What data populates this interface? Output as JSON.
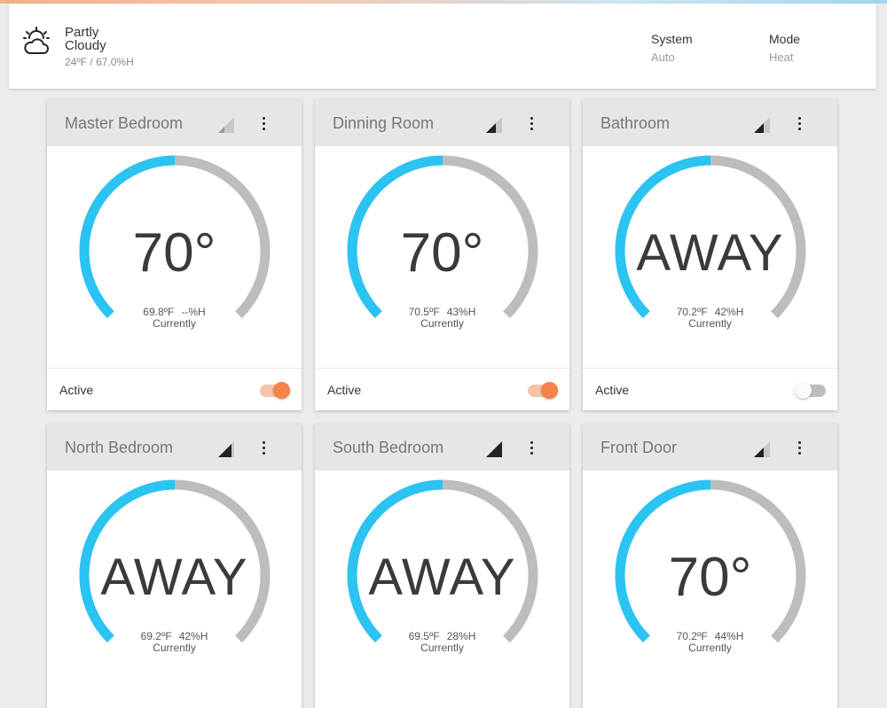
{
  "weather": {
    "condition": "Partly Cloudy",
    "readout": "24ºF / 67.0%H",
    "icon": "partly-cloudy-icon"
  },
  "system": {
    "label": "System",
    "value": "Auto"
  },
  "mode": {
    "label": "Mode",
    "value": "Heat"
  },
  "colors": {
    "accent": "#2bc4f2",
    "track": "#bdbdbd",
    "toggle_on": "#f5834a"
  },
  "thermostats": [
    {
      "name": "Master Bedroom",
      "setpoint": "70°",
      "temp": "69.8ºF",
      "humidity": "--%H",
      "status": "Currently",
      "active_label": "Active",
      "active": true
    },
    {
      "name": "Dinning Room",
      "setpoint": "70°",
      "temp": "70.5ºF",
      "humidity": "43%H",
      "status": "Currently",
      "active_label": "Active",
      "active": true
    },
    {
      "name": "Bathroom",
      "setpoint": "AWAY",
      "temp": "70.2ºF",
      "humidity": "42%H",
      "status": "Currently",
      "active_label": "Active",
      "active": false
    },
    {
      "name": "North Bedroom",
      "setpoint": "AWAY",
      "temp": "69.2ºF",
      "humidity": "42%H",
      "status": "Currently"
    },
    {
      "name": "South Bedroom",
      "setpoint": "AWAY",
      "temp": "69.5ºF",
      "humidity": "28%H",
      "status": "Currently"
    },
    {
      "name": "Front Door",
      "setpoint": "70°",
      "temp": "70.2ºF",
      "humidity": "44%H",
      "status": "Currently"
    }
  ]
}
